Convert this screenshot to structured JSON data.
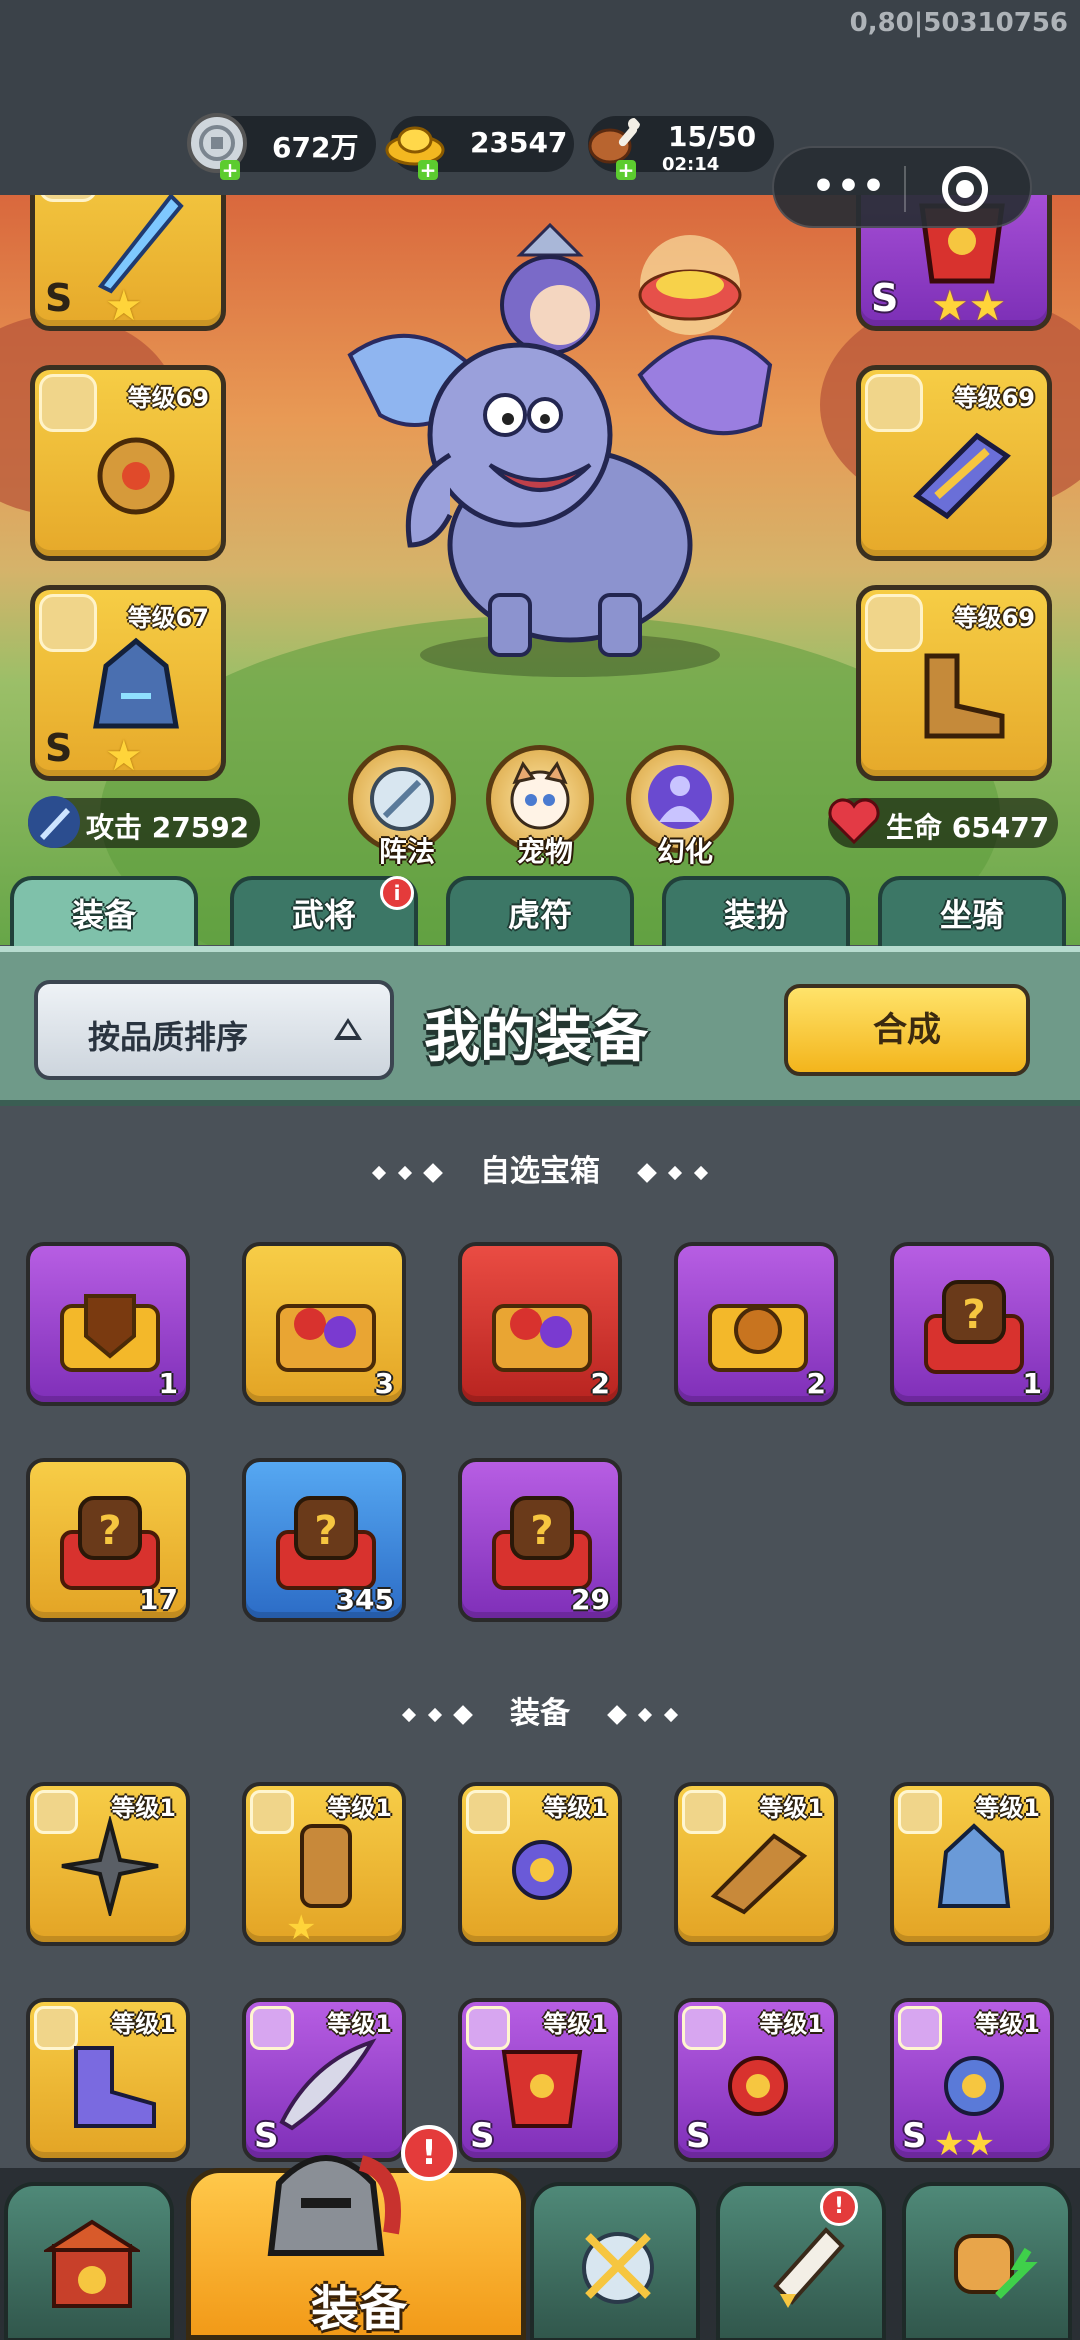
{
  "build_id": "0,80|50310756",
  "resources": {
    "silver": "672万",
    "gold": "23547",
    "food": "15/50",
    "food_timer": "02:14"
  },
  "hero": {
    "attack_label": "攻击 27592",
    "hp_label": "生命 65477",
    "slots_left": [
      {
        "level": "",
        "rarity": "S",
        "stars": 1,
        "color": "gold",
        "icon": "sword-icon"
      },
      {
        "level": "等级69",
        "rarity": "",
        "stars": 0,
        "color": "gold",
        "icon": "amulet-icon"
      },
      {
        "level": "等级67",
        "rarity": "S",
        "stars": 1,
        "color": "gold",
        "icon": "helmet-icon"
      }
    ],
    "slots_right": [
      {
        "level": "",
        "rarity": "S",
        "stars": 2,
        "color": "purple",
        "icon": "armor-icon"
      },
      {
        "level": "等级69",
        "rarity": "",
        "stars": 0,
        "color": "gold",
        "icon": "bracer-icon"
      },
      {
        "level": "等级69",
        "rarity": "",
        "stars": 0,
        "color": "gold",
        "icon": "boots-icon"
      }
    ],
    "buttons": [
      "阵法",
      "宠物",
      "幻化"
    ]
  },
  "tabs": [
    {
      "label": "装备",
      "active": true,
      "badge": ""
    },
    {
      "label": "武将",
      "active": false,
      "badge": "i"
    },
    {
      "label": "虎符",
      "active": false,
      "badge": ""
    },
    {
      "label": "装扮",
      "active": false,
      "badge": ""
    },
    {
      "label": "坐骑",
      "active": false,
      "badge": ""
    }
  ],
  "panel": {
    "sort_label": "按品质排序",
    "title": "我的装备",
    "combine_label": "合成"
  },
  "chest_section": {
    "title": "自选宝箱",
    "items": [
      {
        "color": "purple",
        "count": "1",
        "icon": "shield-chest-icon"
      },
      {
        "color": "gold",
        "count": "3",
        "icon": "puzzle-chest-icon"
      },
      {
        "color": "red",
        "count": "2",
        "icon": "puzzle-chest-icon"
      },
      {
        "color": "purple",
        "count": "2",
        "icon": "lion-chest-icon"
      },
      {
        "color": "purple",
        "count": "1",
        "icon": "mystery-chest-icon"
      },
      {
        "color": "gold",
        "count": "17",
        "icon": "mystery-chest-icon"
      },
      {
        "color": "blue",
        "count": "345",
        "icon": "mystery-chest-icon"
      },
      {
        "color": "purple",
        "count": "29",
        "icon": "mystery-chest-icon"
      }
    ]
  },
  "equip_section": {
    "title": "装备",
    "items": [
      {
        "color": "gold",
        "level": "等级1",
        "rarity": "",
        "stars": 0,
        "icon": "shuriken-icon"
      },
      {
        "color": "gold",
        "level": "等级1",
        "rarity": "",
        "stars": 1,
        "icon": "bracer-icon"
      },
      {
        "color": "gold",
        "level": "等级1",
        "rarity": "",
        "stars": 0,
        "icon": "amulet-icon"
      },
      {
        "color": "gold",
        "level": "等级1",
        "rarity": "",
        "stars": 0,
        "icon": "bracer-icon"
      },
      {
        "color": "gold",
        "level": "等级1",
        "rarity": "",
        "stars": 0,
        "icon": "helmet-icon"
      },
      {
        "color": "gold",
        "level": "等级1",
        "rarity": "",
        "stars": 0,
        "icon": "boots-icon"
      },
      {
        "color": "purple",
        "level": "等级1",
        "rarity": "S",
        "stars": 0,
        "icon": "sword-icon"
      },
      {
        "color": "purple",
        "level": "等级1",
        "rarity": "S",
        "stars": 0,
        "icon": "armor-icon"
      },
      {
        "color": "purple",
        "level": "等级1",
        "rarity": "S",
        "stars": 0,
        "icon": "amulet-icon"
      },
      {
        "color": "purple",
        "level": "等级1",
        "rarity": "S",
        "stars": 2,
        "icon": "amulet-icon"
      }
    ]
  },
  "bottom_nav": {
    "active_label": "装备",
    "active_badge": "!",
    "items": [
      {
        "icon": "gate-icon",
        "badge": ""
      },
      {
        "icon": "crossed-swords-icon",
        "badge": ""
      },
      {
        "icon": "scroll-icon",
        "badge": "!"
      },
      {
        "icon": "fist-upgrade-icon",
        "badge": ""
      }
    ]
  },
  "colors": {
    "gold": "#f2c13c",
    "purple": "#9b45cf",
    "red": "#d63631",
    "blue": "#3f8be0",
    "tab_active": "#7fc1aa",
    "background": "#4a5158"
  }
}
